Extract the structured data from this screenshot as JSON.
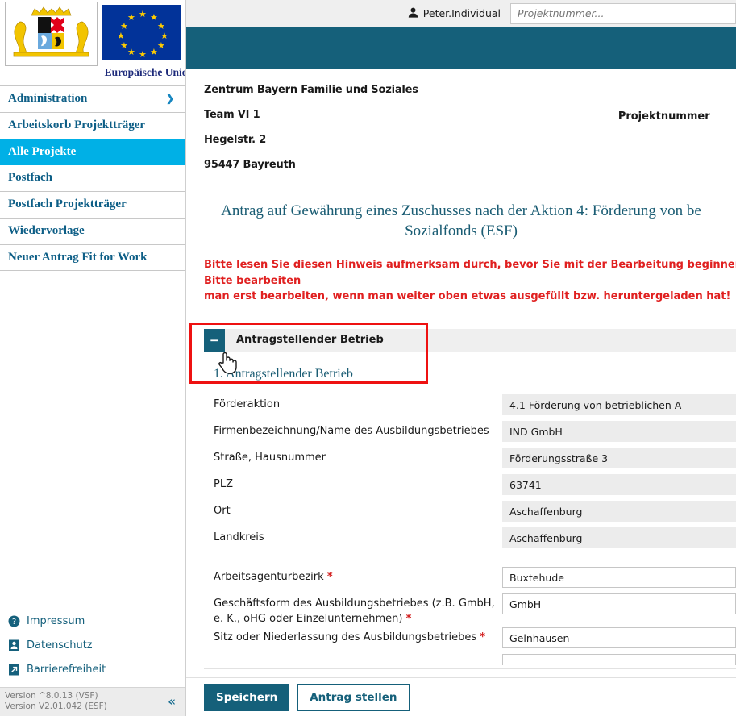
{
  "sidebar": {
    "eu_label": "Europäische Union",
    "nav_items": [
      {
        "label": "Administration",
        "has_chevron": true,
        "active": false
      },
      {
        "label": "Arbeitskorb Projektträger",
        "has_chevron": false,
        "active": false
      },
      {
        "label": "Alle Projekte",
        "has_chevron": false,
        "active": true
      },
      {
        "label": "Postfach",
        "has_chevron": false,
        "active": false
      },
      {
        "label": "Postfach Projektträger",
        "has_chevron": false,
        "active": false
      },
      {
        "label": "Wiedervorlage",
        "has_chevron": false,
        "active": false
      },
      {
        "label": "Neuer Antrag Fit for Work",
        "has_chevron": false,
        "active": false
      }
    ],
    "footer_links": [
      {
        "label": "Impressum",
        "icon": "help-circle-icon"
      },
      {
        "label": "Datenschutz",
        "icon": "privacy-badge-icon"
      },
      {
        "label": "Barrierefreiheit",
        "icon": "arrow-external-icon"
      }
    ],
    "version_line1": "Version ^8.0.13 (VSF)",
    "version_line2": "Version V2.01.042 (ESF)",
    "collapse_icon": "«"
  },
  "topbar": {
    "user_name": "Peter.Individual",
    "user_icon": "person-icon",
    "search_placeholder": "Projektnummer..."
  },
  "document": {
    "address_lines": [
      "Zentrum Bayern Familie und Soziales",
      "Team VI 1",
      "Hegelstr. 2",
      "95447 Bayreuth"
    ],
    "project_number_label": "Projektnummer",
    "title_line1": "Antrag auf Gewährung eines Zuschusses nach der Aktion 4: Förderung von be",
    "title_line2": "Sozialfonds (ESF)",
    "notice_bold": "Bitte lesen Sie diesen Hinweis aufmerksam durch, bevor Sie mit der Bearbeitung beginnen",
    "notice_rest": ": Bitte bearbeiten",
    "notice_line2": "man erst bearbeiten, wenn man weiter oben etwas ausgefüllt bzw. heruntergeladen hat!"
  },
  "accordion": {
    "toggle_symbol": "−",
    "header_title": "Antragstellender Betrieb",
    "section_subtitle": "1. Antragstellender Betrieb"
  },
  "form": {
    "fields": [
      {
        "label": "Förderaktion",
        "value": "4.1 Förderung von betrieblichen A",
        "required": false,
        "editable": false
      },
      {
        "label": "Firmenbezeichnung/Name des Ausbildungsbetriebes",
        "value": "IND GmbH",
        "required": false,
        "editable": false
      },
      {
        "label": "Straße, Hausnummer",
        "value": "Förderungsstraße 3",
        "required": false,
        "editable": false
      },
      {
        "label": "PLZ",
        "value": "63741",
        "required": false,
        "editable": false
      },
      {
        "label": "Ort",
        "value": "Aschaffenburg",
        "required": false,
        "editable": false
      },
      {
        "label": "Landkreis",
        "value": "Aschaffenburg",
        "required": false,
        "editable": false
      },
      {
        "label": "Arbeitsagenturbezirk ",
        "value": "Buxtehude",
        "required": true,
        "editable": true
      },
      {
        "label": "Geschäftsform des Ausbildungsbetriebes (z.B. GmbH, e. K., oHG oder Einzelunternehmen) ",
        "value": "GmbH",
        "required": true,
        "editable": true
      },
      {
        "label": "Sitz oder Niederlassung des Ausbildungsbetriebes ",
        "value": "Gelnhausen",
        "required": true,
        "editable": true
      }
    ]
  },
  "buttons": {
    "save_label": "Speichern",
    "submit_label": "Antrag stellen"
  },
  "colors": {
    "teal": "#15607a",
    "cyan_active": "#00b0e6",
    "notice_red": "#e02020",
    "highlight_box_red": "#ee1111"
  }
}
